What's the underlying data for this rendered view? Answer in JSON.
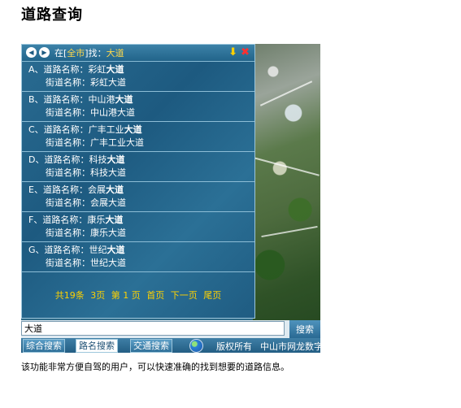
{
  "page": {
    "title": "道路查询",
    "description": "该功能非常方便自驾的用户，可以快速准确的找到想要的道路信息。"
  },
  "header": {
    "prefix": "在[",
    "scope": "全市",
    "suffix": "]找：",
    "keyword": "大道",
    "prev_icon": "chevron-left-icon",
    "next_icon": "chevron-right-icon",
    "down_icon": "arrow-down-icon",
    "close_icon": "close-icon"
  },
  "results": [
    {
      "letter": "A、",
      "road_label": "道路名称：",
      "road_prefix": "彩虹",
      "road_bold": "大道",
      "street_label": "街道名称：",
      "street": "彩虹大道"
    },
    {
      "letter": "B、",
      "road_label": "道路名称：",
      "road_prefix": "中山港",
      "road_bold": "大道",
      "street_label": "街道名称：",
      "street": "中山港大道"
    },
    {
      "letter": "C、",
      "road_label": "道路名称：",
      "road_prefix": "广丰工业",
      "road_bold": "大道",
      "street_label": "街道名称：",
      "street": "广丰工业大道"
    },
    {
      "letter": "D、",
      "road_label": "道路名称：",
      "road_prefix": "科技",
      "road_bold": "大道",
      "street_label": "街道名称：",
      "street": "科技大道"
    },
    {
      "letter": "E、",
      "road_label": "道路名称：",
      "road_prefix": "会展",
      "road_bold": "大道",
      "street_label": "街道名称：",
      "street": "会展大道"
    },
    {
      "letter": "F、",
      "road_label": "道路名称：",
      "road_prefix": "康乐",
      "road_bold": "大道",
      "street_label": "街道名称：",
      "street": "康乐大道"
    },
    {
      "letter": "G、",
      "road_label": "道路名称：",
      "road_prefix": "世纪",
      "road_bold": "大道",
      "street_label": "街道名称：",
      "street": "世纪大道"
    }
  ],
  "pager": {
    "total": "共19条",
    "pages": "3页",
    "current": "第 1 页",
    "first": "首页",
    "next": "下一页",
    "last": "尾页"
  },
  "search": {
    "value": "大道",
    "button": "搜索"
  },
  "tabs": [
    {
      "label": "综合搜索"
    },
    {
      "label": "路名搜索"
    },
    {
      "label": "交通搜索"
    }
  ],
  "footer": {
    "copyright": "版权所有",
    "company": "中山市网龙数字"
  },
  "colors": {
    "panel": "#1d5a80",
    "highlight": "#ffd84a",
    "pager": "#ffd200"
  }
}
